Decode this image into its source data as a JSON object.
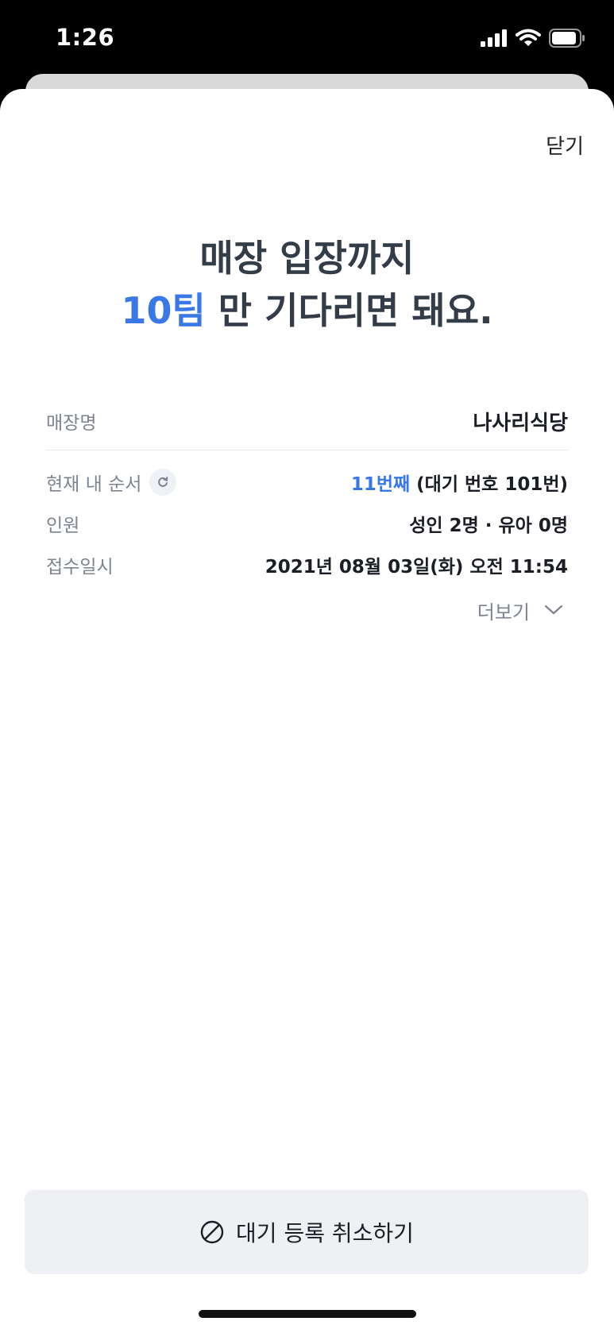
{
  "status_bar": {
    "time": "1:26"
  },
  "header": {
    "close_label": "닫기"
  },
  "headline": {
    "line1": "매장 입장까지",
    "teams": "10팀",
    "line2_rest": " 만 기다리면 돼요."
  },
  "details": {
    "store_label": "매장명",
    "store_value": "나사리식당",
    "order_label": "현재 내 순서",
    "order_position": "11번째",
    "order_wait_number": " (대기 번호 101번)",
    "people_label": "인원",
    "people_value": "성인 2명 · 유아 0명",
    "received_label": "접수일시",
    "received_value": "2021년 08월 03일(화) 오전 11:54",
    "more_label": "더보기"
  },
  "footer": {
    "cancel_label": "대기 등록 취소하기"
  },
  "colors": {
    "accent": "#3b78e7",
    "text_primary": "#1b1f25",
    "text_secondary": "#7d848f",
    "button_bg": "#eef0f3"
  },
  "icons": [
    "signal-icon",
    "wifi-icon",
    "battery-icon",
    "refresh-icon",
    "chevron-down-icon",
    "cancel-icon"
  ]
}
